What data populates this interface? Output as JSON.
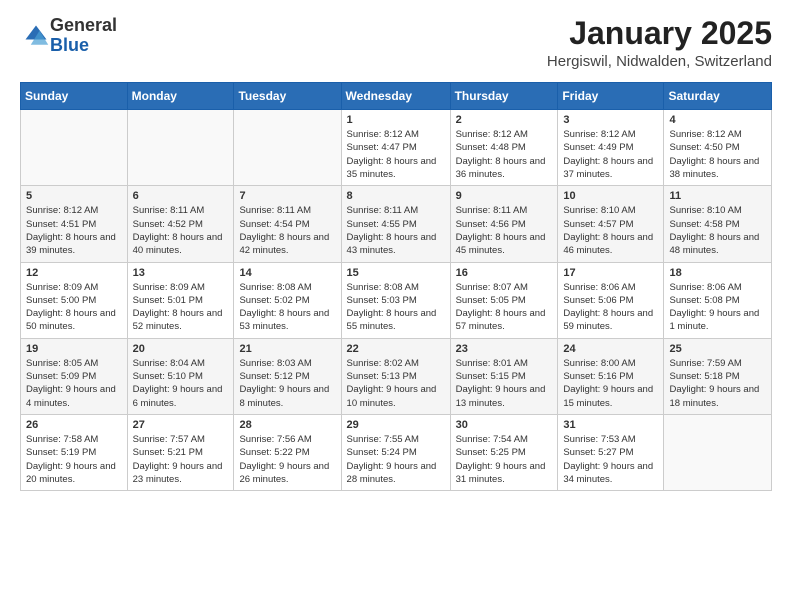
{
  "logo": {
    "general": "General",
    "blue": "Blue"
  },
  "header": {
    "month": "January 2025",
    "location": "Hergiswil, Nidwalden, Switzerland"
  },
  "weekdays": [
    "Sunday",
    "Monday",
    "Tuesday",
    "Wednesday",
    "Thursday",
    "Friday",
    "Saturday"
  ],
  "weeks": [
    [
      {
        "day": "",
        "info": ""
      },
      {
        "day": "",
        "info": ""
      },
      {
        "day": "",
        "info": ""
      },
      {
        "day": "1",
        "info": "Sunrise: 8:12 AM\nSunset: 4:47 PM\nDaylight: 8 hours and 35 minutes."
      },
      {
        "day": "2",
        "info": "Sunrise: 8:12 AM\nSunset: 4:48 PM\nDaylight: 8 hours and 36 minutes."
      },
      {
        "day": "3",
        "info": "Sunrise: 8:12 AM\nSunset: 4:49 PM\nDaylight: 8 hours and 37 minutes."
      },
      {
        "day": "4",
        "info": "Sunrise: 8:12 AM\nSunset: 4:50 PM\nDaylight: 8 hours and 38 minutes."
      }
    ],
    [
      {
        "day": "5",
        "info": "Sunrise: 8:12 AM\nSunset: 4:51 PM\nDaylight: 8 hours and 39 minutes."
      },
      {
        "day": "6",
        "info": "Sunrise: 8:11 AM\nSunset: 4:52 PM\nDaylight: 8 hours and 40 minutes."
      },
      {
        "day": "7",
        "info": "Sunrise: 8:11 AM\nSunset: 4:54 PM\nDaylight: 8 hours and 42 minutes."
      },
      {
        "day": "8",
        "info": "Sunrise: 8:11 AM\nSunset: 4:55 PM\nDaylight: 8 hours and 43 minutes."
      },
      {
        "day": "9",
        "info": "Sunrise: 8:11 AM\nSunset: 4:56 PM\nDaylight: 8 hours and 45 minutes."
      },
      {
        "day": "10",
        "info": "Sunrise: 8:10 AM\nSunset: 4:57 PM\nDaylight: 8 hours and 46 minutes."
      },
      {
        "day": "11",
        "info": "Sunrise: 8:10 AM\nSunset: 4:58 PM\nDaylight: 8 hours and 48 minutes."
      }
    ],
    [
      {
        "day": "12",
        "info": "Sunrise: 8:09 AM\nSunset: 5:00 PM\nDaylight: 8 hours and 50 minutes."
      },
      {
        "day": "13",
        "info": "Sunrise: 8:09 AM\nSunset: 5:01 PM\nDaylight: 8 hours and 52 minutes."
      },
      {
        "day": "14",
        "info": "Sunrise: 8:08 AM\nSunset: 5:02 PM\nDaylight: 8 hours and 53 minutes."
      },
      {
        "day": "15",
        "info": "Sunrise: 8:08 AM\nSunset: 5:03 PM\nDaylight: 8 hours and 55 minutes."
      },
      {
        "day": "16",
        "info": "Sunrise: 8:07 AM\nSunset: 5:05 PM\nDaylight: 8 hours and 57 minutes."
      },
      {
        "day": "17",
        "info": "Sunrise: 8:06 AM\nSunset: 5:06 PM\nDaylight: 8 hours and 59 minutes."
      },
      {
        "day": "18",
        "info": "Sunrise: 8:06 AM\nSunset: 5:08 PM\nDaylight: 9 hours and 1 minute."
      }
    ],
    [
      {
        "day": "19",
        "info": "Sunrise: 8:05 AM\nSunset: 5:09 PM\nDaylight: 9 hours and 4 minutes."
      },
      {
        "day": "20",
        "info": "Sunrise: 8:04 AM\nSunset: 5:10 PM\nDaylight: 9 hours and 6 minutes."
      },
      {
        "day": "21",
        "info": "Sunrise: 8:03 AM\nSunset: 5:12 PM\nDaylight: 9 hours and 8 minutes."
      },
      {
        "day": "22",
        "info": "Sunrise: 8:02 AM\nSunset: 5:13 PM\nDaylight: 9 hours and 10 minutes."
      },
      {
        "day": "23",
        "info": "Sunrise: 8:01 AM\nSunset: 5:15 PM\nDaylight: 9 hours and 13 minutes."
      },
      {
        "day": "24",
        "info": "Sunrise: 8:00 AM\nSunset: 5:16 PM\nDaylight: 9 hours and 15 minutes."
      },
      {
        "day": "25",
        "info": "Sunrise: 7:59 AM\nSunset: 5:18 PM\nDaylight: 9 hours and 18 minutes."
      }
    ],
    [
      {
        "day": "26",
        "info": "Sunrise: 7:58 AM\nSunset: 5:19 PM\nDaylight: 9 hours and 20 minutes."
      },
      {
        "day": "27",
        "info": "Sunrise: 7:57 AM\nSunset: 5:21 PM\nDaylight: 9 hours and 23 minutes."
      },
      {
        "day": "28",
        "info": "Sunrise: 7:56 AM\nSunset: 5:22 PM\nDaylight: 9 hours and 26 minutes."
      },
      {
        "day": "29",
        "info": "Sunrise: 7:55 AM\nSunset: 5:24 PM\nDaylight: 9 hours and 28 minutes."
      },
      {
        "day": "30",
        "info": "Sunrise: 7:54 AM\nSunset: 5:25 PM\nDaylight: 9 hours and 31 minutes."
      },
      {
        "day": "31",
        "info": "Sunrise: 7:53 AM\nSunset: 5:27 PM\nDaylight: 9 hours and 34 minutes."
      },
      {
        "day": "",
        "info": ""
      }
    ]
  ]
}
